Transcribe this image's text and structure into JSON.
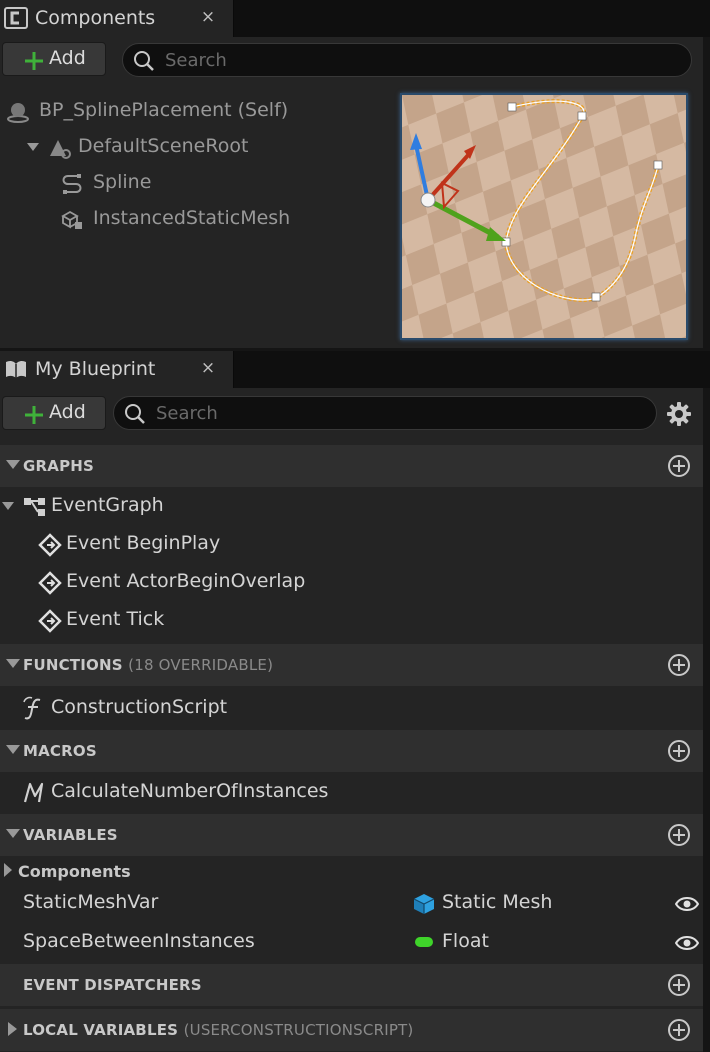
{
  "components_tab": {
    "title": "Components",
    "close": "×"
  },
  "components_toolbar": {
    "add_label": "Add",
    "search_placeholder": "Search"
  },
  "components_tree": {
    "root": "BP_SplinePlacement (Self)",
    "scene_root": "DefaultSceneRoot",
    "spline": "Spline",
    "ism": "InstancedStaticMesh"
  },
  "blueprint_tab": {
    "title": "My Blueprint",
    "close": "×"
  },
  "blueprint_toolbar": {
    "add_label": "Add",
    "search_placeholder": "Search"
  },
  "sections": {
    "graphs": {
      "title": "GRAPHS"
    },
    "functions": {
      "title": "FUNCTIONS",
      "sub": "(18 OVERRIDABLE)"
    },
    "macros": {
      "title": "MACROS"
    },
    "variables": {
      "title": "VARIABLES"
    },
    "dispatchers": {
      "title": "EVENT DISPATCHERS"
    },
    "locals": {
      "title": "LOCAL VARIABLES",
      "sub": "(USERCONSTRUCTIONSCRIPT)"
    }
  },
  "graphs": {
    "event_graph": "EventGraph",
    "events": [
      "Event BeginPlay",
      "Event ActorBeginOverlap",
      "Event Tick"
    ]
  },
  "functions": {
    "items": [
      "ConstructionScript"
    ]
  },
  "macros": {
    "items": [
      "CalculateNumberOfInstances"
    ]
  },
  "variables": {
    "category": "Components",
    "items": [
      {
        "name": "StaticMeshVar",
        "type": "Static Mesh",
        "type_color": "#2ea1e0"
      },
      {
        "name": "SpaceBetweenInstances",
        "type": "Float",
        "type_color": "#3fd42a"
      }
    ]
  },
  "colors": {
    "panel_bg": "#242424",
    "section_header_bg": "#2f2f2f",
    "add_plus_green": "#3fb23a",
    "viewport_border": "#2a4a6a",
    "spline_orange": "#e8a02a"
  },
  "icons": {
    "components_tab": "class-icon",
    "blueprint_tab": "book-icon",
    "add": "plus-icon",
    "search": "search-icon",
    "settings": "gear-icon",
    "section_add": "circle-plus-icon",
    "visibility": "eye-icon"
  }
}
